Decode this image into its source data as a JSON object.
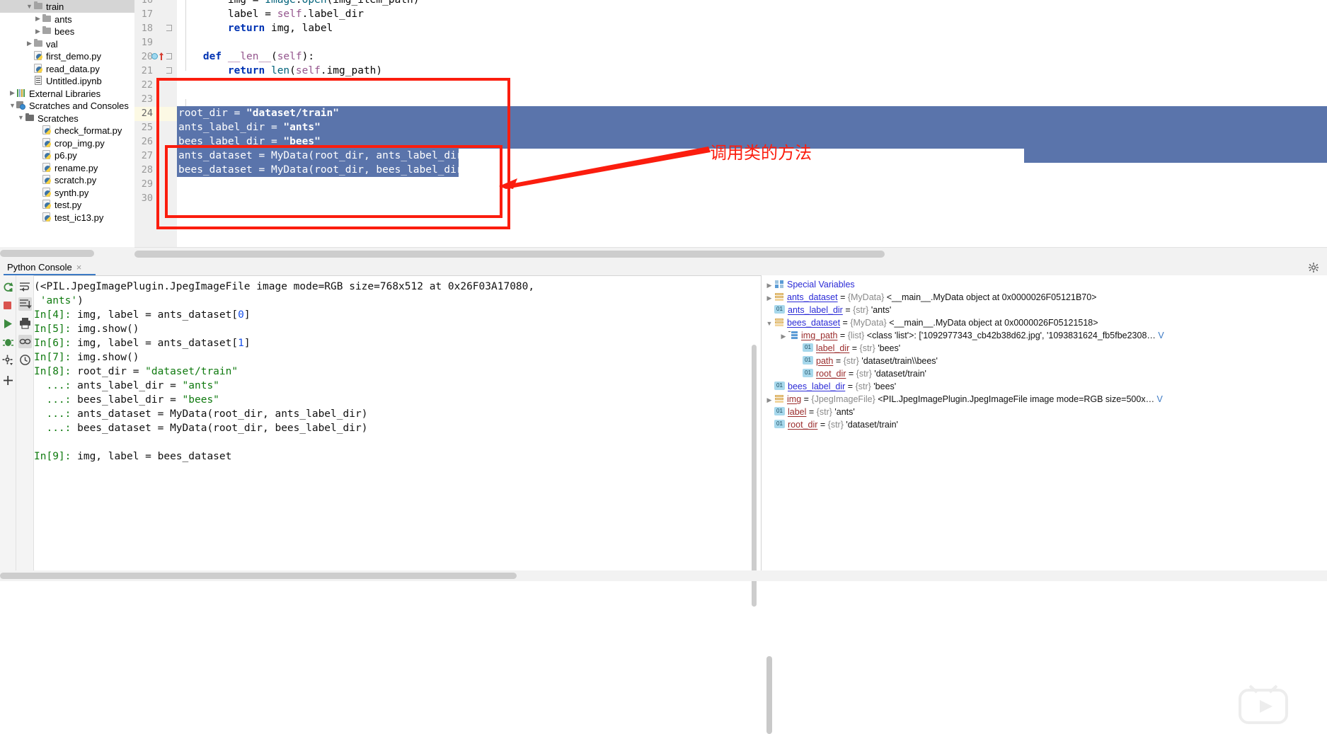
{
  "project_tree": {
    "items": [
      {
        "indent": 3,
        "arrow": "v",
        "icon": "folder",
        "label": "train",
        "selected": true
      },
      {
        "indent": 4,
        "arrow": ">",
        "icon": "folder",
        "label": "ants",
        "selected": false
      },
      {
        "indent": 4,
        "arrow": ">",
        "icon": "folder",
        "label": "bees",
        "selected": false
      },
      {
        "indent": 3,
        "arrow": ">",
        "icon": "folder",
        "label": "val",
        "selected": false
      },
      {
        "indent": 3,
        "arrow": "",
        "icon": "py",
        "label": "first_demo.py",
        "selected": false
      },
      {
        "indent": 3,
        "arrow": "",
        "icon": "py",
        "label": "read_data.py",
        "selected": false
      },
      {
        "indent": 3,
        "arrow": "",
        "icon": "nb",
        "label": "Untitled.ipynb",
        "selected": false
      },
      {
        "indent": 1,
        "arrow": ">",
        "icon": "lib",
        "label": "External Libraries",
        "selected": false
      },
      {
        "indent": 1,
        "arrow": "v",
        "icon": "scratchconsole",
        "label": "Scratches and Consoles",
        "selected": false
      },
      {
        "indent": 2,
        "arrow": "v",
        "icon": "folderdark",
        "label": "Scratches",
        "selected": false
      },
      {
        "indent": 4,
        "arrow": "",
        "icon": "py",
        "label": "check_format.py",
        "selected": false
      },
      {
        "indent": 4,
        "arrow": "",
        "icon": "py",
        "label": "crop_img.py",
        "selected": false
      },
      {
        "indent": 4,
        "arrow": "",
        "icon": "py",
        "label": "p6.py",
        "selected": false
      },
      {
        "indent": 4,
        "arrow": "",
        "icon": "py",
        "label": "rename.py",
        "selected": false
      },
      {
        "indent": 4,
        "arrow": "",
        "icon": "py",
        "label": "scratch.py",
        "selected": false
      },
      {
        "indent": 4,
        "arrow": "",
        "icon": "py",
        "label": "synth.py",
        "selected": false
      },
      {
        "indent": 4,
        "arrow": "",
        "icon": "py",
        "label": "test.py",
        "selected": false
      },
      {
        "indent": 4,
        "arrow": "",
        "icon": "py",
        "label": "test_ic13.py",
        "selected": false
      }
    ]
  },
  "editor": {
    "line_numbers": [
      "16",
      "17",
      "18",
      "19",
      "20",
      "21",
      "22",
      "23",
      "24",
      "25",
      "26",
      "27",
      "28",
      "29",
      "30"
    ],
    "current_line": "24",
    "lines": [
      {
        "n": "16",
        "text": "        img = Image.open(img_item_path)"
      },
      {
        "n": "17",
        "text": "        label = self.label_dir"
      },
      {
        "n": "18",
        "text": "        return img, label"
      },
      {
        "n": "19",
        "text": ""
      },
      {
        "n": "20",
        "text": "    def __len__(self):"
      },
      {
        "n": "21",
        "text": "        return len(self.img_path)"
      },
      {
        "n": "22",
        "text": ""
      },
      {
        "n": "23",
        "text": ""
      },
      {
        "n": "24",
        "text": "root_dir = \"dataset/train\""
      },
      {
        "n": "25",
        "text": "ants_label_dir = \"ants\""
      },
      {
        "n": "26",
        "text": "bees_label_dir = \"bees\""
      },
      {
        "n": "27",
        "text": "ants_dataset = MyData(root_dir, ants_label_dir)"
      },
      {
        "n": "28",
        "text": "bees_dataset = MyData(root_dir, bees_label_dir)"
      },
      {
        "n": "29",
        "text": ""
      },
      {
        "n": "30",
        "text": ""
      }
    ]
  },
  "annotation": {
    "note_text": "调用类的方法",
    "color": "#fb1d0e"
  },
  "console": {
    "tab_label": "Python Console",
    "tab_close": "×",
    "settings_icon": "gear-icon",
    "toolbar_left": [
      "rerun-icon",
      "stop-icon",
      "execute-icon",
      "debug-icon",
      "settings-icon",
      "add-icon"
    ],
    "toolbar_right": [
      "soft-wrap-icon",
      "scroll-to-end-icon",
      "print-icon",
      "use-existing-icon",
      "history-icon"
    ],
    "output_lines": [
      {
        "t": "(<PIL.JpegImagePlugin.JpegImageFile image mode=RGB size=768x512 at 0x26F03A17080,"
      },
      {
        "t": " 'ants')"
      },
      {
        "t": "In[4]: img, label = ants_dataset[0]"
      },
      {
        "t": "In[5]: img.show()"
      },
      {
        "t": "In[6]: img, label = ants_dataset[1]"
      },
      {
        "t": "In[7]: img.show()"
      },
      {
        "t": "In[8]: root_dir = \"dataset/train\""
      },
      {
        "t": "  ...: ants_label_dir = \"ants\""
      },
      {
        "t": "  ...: bees_label_dir = \"bees\""
      },
      {
        "t": "  ...: ants_dataset = MyData(root_dir, ants_label_dir)"
      },
      {
        "t": "  ...: bees_dataset = MyData(root_dir, bees_label_dir)"
      },
      {
        "t": ""
      },
      {
        "t": "In[9]: img, label = bees_dataset"
      }
    ]
  },
  "variables": {
    "rows": [
      {
        "indent": 0,
        "arrow": ">",
        "icon": "special",
        "name": "Special Variables",
        "eq": "",
        "type": "",
        "value": "",
        "more": ""
      },
      {
        "indent": 0,
        "arrow": ">",
        "icon": "list",
        "name": "ants_dataset",
        "eq": " = ",
        "type": "{MyData}",
        "value": " <__main__.MyData object at 0x0000026F05121B70>",
        "more": ""
      },
      {
        "indent": 0,
        "arrow": "",
        "icon": "01",
        "name": "ants_label_dir",
        "eq": " = ",
        "type": "{str}",
        "value": " 'ants'",
        "more": ""
      },
      {
        "indent": 0,
        "arrow": "v",
        "icon": "list",
        "name": "bees_dataset",
        "eq": " = ",
        "type": "{MyData}",
        "value": " <__main__.MyData object at 0x0000026F05121518>",
        "more": ""
      },
      {
        "indent": 1,
        "arrow": ">",
        "icon": "olist",
        "name": "img_path",
        "eq": " = ",
        "type": "{list}",
        "value": " <class 'list'>: ['1092977343_cb42b38d62.jpg', '1093831624_fb5fbe2308…",
        "more": " V"
      },
      {
        "indent": 2,
        "arrow": "",
        "icon": "01",
        "name": "label_dir",
        "eq": " = ",
        "type": "{str}",
        "value": " 'bees'",
        "more": ""
      },
      {
        "indent": 2,
        "arrow": "",
        "icon": "01",
        "name": "path",
        "eq": " = ",
        "type": "{str}",
        "value": " 'dataset/train\\\\bees'",
        "more": ""
      },
      {
        "indent": 2,
        "arrow": "",
        "icon": "01",
        "name": "root_dir",
        "eq": " = ",
        "type": "{str}",
        "value": " 'dataset/train'",
        "more": ""
      },
      {
        "indent": 0,
        "arrow": "",
        "icon": "01",
        "name": "bees_label_dir",
        "eq": " = ",
        "type": "{str}",
        "value": " 'bees'",
        "more": ""
      },
      {
        "indent": 0,
        "arrow": ">",
        "icon": "list",
        "name": "img",
        "eq": " = ",
        "type": "{JpegImageFile}",
        "value": " <PIL.JpegImagePlugin.JpegImageFile image mode=RGB size=500x…",
        "more": " V"
      },
      {
        "indent": 0,
        "arrow": "",
        "icon": "01",
        "name": "label",
        "eq": " = ",
        "type": "{str}",
        "value": " 'ants'",
        "more": ""
      },
      {
        "indent": 0,
        "arrow": "",
        "icon": "01",
        "name": "root_dir",
        "eq": " = ",
        "type": "{str}",
        "value": " 'dataset/train'",
        "more": ""
      }
    ]
  }
}
